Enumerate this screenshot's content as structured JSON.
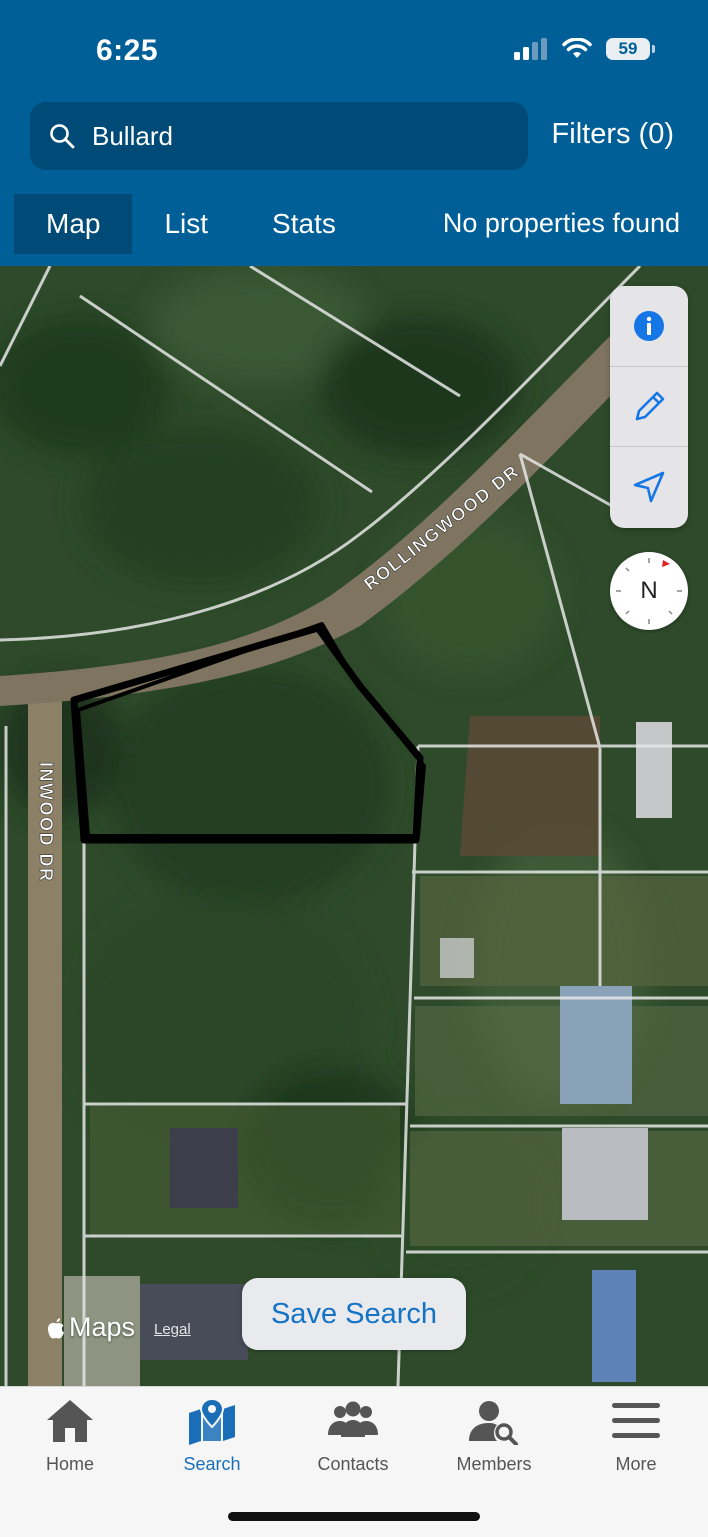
{
  "status_bar": {
    "time": "6:25",
    "battery": "59"
  },
  "search": {
    "query": "Bullard",
    "filters_label": "Filters (0)"
  },
  "view_tabs": [
    {
      "label": "Map",
      "active": true
    },
    {
      "label": "List",
      "active": false
    },
    {
      "label": "Stats",
      "active": false
    }
  ],
  "result_status": "No properties found",
  "map": {
    "streets": [
      "ROLLINGWOOD DR",
      "INWOOD DR"
    ],
    "controls": [
      "info-icon",
      "pencil-icon",
      "location-arrow-icon"
    ],
    "compass_label": "N",
    "attribution": {
      "brand": "Maps",
      "legal": "Legal"
    }
  },
  "save_search_label": "Save Search",
  "tab_bar": [
    {
      "label": "Home",
      "icon": "home-icon",
      "active": false
    },
    {
      "label": "Search",
      "icon": "map-pin-icon",
      "active": true
    },
    {
      "label": "Contacts",
      "icon": "contacts-icon",
      "active": false
    },
    {
      "label": "Members",
      "icon": "members-search-icon",
      "active": false
    },
    {
      "label": "More",
      "icon": "menu-icon",
      "active": false
    }
  ],
  "colors": {
    "header": "#005f97",
    "accent": "#1a6eb8",
    "search_field": "#004a78"
  }
}
